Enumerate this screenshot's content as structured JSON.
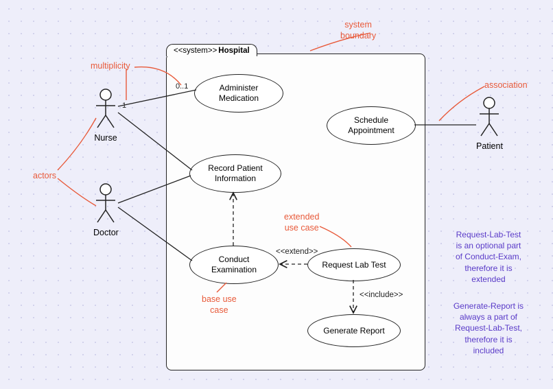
{
  "system": {
    "stereotype": "<<system>>",
    "name": "Hospital"
  },
  "actors": {
    "nurse": {
      "label": "Nurse"
    },
    "doctor": {
      "label": "Doctor"
    },
    "patient": {
      "label": "Patient"
    }
  },
  "usecases": {
    "administer": {
      "label": "Administer\nMedication"
    },
    "schedule": {
      "label": "Schedule\nAppointment"
    },
    "record": {
      "label": "Record Patient\nInformation"
    },
    "conduct": {
      "label": "Conduct\nExamination"
    },
    "request": {
      "label": "Request Lab Test"
    },
    "generate": {
      "label": "Generate Report"
    }
  },
  "rel_labels": {
    "extend": "<<extend>>",
    "include": "<<include>>"
  },
  "multiplicities": {
    "nurse_side": "1",
    "admin_side": "0..1"
  },
  "annotations": {
    "system_boundary": "system\nboundary",
    "multiplicity": "multiplicity",
    "actors": "actors",
    "association": "association",
    "extended_uc": "extended\nuse case",
    "base_uc": "base use\ncase",
    "note_extend": "Request-Lab-Test\nis an optional part\nof Conduct-Exam,\ntherefore it is\nextended",
    "note_include": "Generate-Report is\nalways a part of\nRequest-Lab-Test,\ntherefore it is\nincluded"
  },
  "chart_data": {
    "type": "uml-use-case",
    "system": "Hospital",
    "actors": [
      "Nurse",
      "Doctor",
      "Patient"
    ],
    "use_cases": [
      "Administer Medication",
      "Schedule Appointment",
      "Record Patient Information",
      "Conduct Examination",
      "Request Lab Test",
      "Generate Report"
    ],
    "associations": [
      {
        "actor": "Nurse",
        "use_case": "Administer Medication",
        "multiplicity_actor": "1",
        "multiplicity_uc": "0..1"
      },
      {
        "actor": "Nurse",
        "use_case": "Record Patient Information"
      },
      {
        "actor": "Doctor",
        "use_case": "Record Patient Information"
      },
      {
        "actor": "Doctor",
        "use_case": "Conduct Examination"
      },
      {
        "actor": "Patient",
        "use_case": "Schedule Appointment"
      }
    ],
    "extend": [
      {
        "from": "Request Lab Test",
        "to": "Conduct Examination"
      }
    ],
    "include": [
      {
        "from": "Request Lab Test",
        "to": "Generate Report"
      }
    ],
    "callouts": [
      {
        "text": "system boundary",
        "points_to": "system box border"
      },
      {
        "text": "multiplicity",
        "points_to": "1 / 0..1 labels"
      },
      {
        "text": "actors",
        "points_to": "Nurse & Doctor figures"
      },
      {
        "text": "association",
        "points_to": "Patient–Schedule line"
      },
      {
        "text": "extended use case",
        "points_to": "Request Lab Test"
      },
      {
        "text": "base use case",
        "points_to": "Conduct Examination"
      }
    ]
  }
}
